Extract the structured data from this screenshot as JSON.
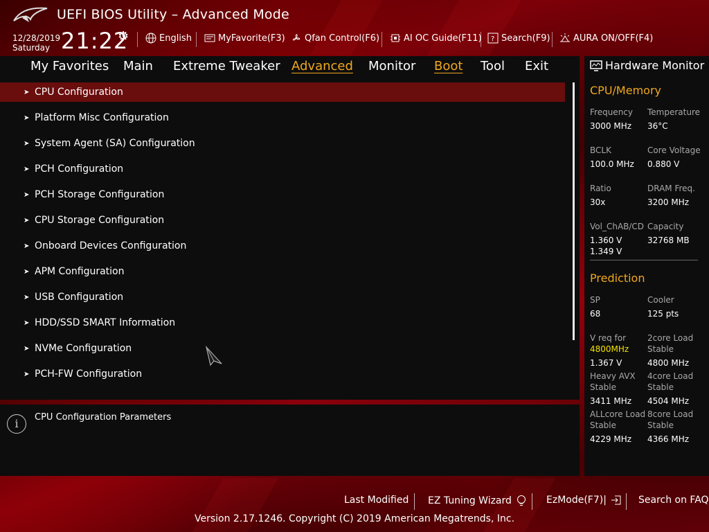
{
  "header": {
    "title": "UEFI BIOS Utility – Advanced Mode",
    "date": "12/28/2019",
    "day": "Saturday",
    "time": "21:22",
    "tools": [
      {
        "label": "English",
        "icon": "globe-icon"
      },
      {
        "label": "MyFavorite(F3)",
        "icon": "favorite-icon"
      },
      {
        "label": "Qfan Control(F6)",
        "icon": "fan-icon"
      },
      {
        "label": "AI OC Guide(F11)",
        "icon": "ai-guide-icon"
      },
      {
        "label": "Search(F9)",
        "icon": "search-icon"
      },
      {
        "label": "AURA ON/OFF(F4)",
        "icon": "aura-icon"
      }
    ]
  },
  "nav": {
    "tabs": [
      "My Favorites",
      "Main",
      "Extreme Tweaker",
      "Advanced",
      "Monitor",
      "Boot",
      "Tool",
      "Exit"
    ],
    "active": [
      "Advanced",
      "Boot"
    ]
  },
  "menu": {
    "items": [
      "CPU Configuration",
      "Platform Misc Configuration",
      "System Agent (SA) Configuration",
      "PCH Configuration",
      "PCH Storage Configuration",
      "CPU Storage Configuration",
      "Onboard Devices Configuration",
      "APM Configuration",
      "USB Configuration",
      "HDD/SSD SMART Information",
      "NVMe Configuration",
      "PCH-FW Configuration"
    ],
    "selected_index": 0
  },
  "help": {
    "text": "CPU Configuration Parameters"
  },
  "hardware_monitor": {
    "title": "Hardware Monitor",
    "cpu_memory": {
      "heading": "CPU/Memory",
      "frequency_label": "Frequency",
      "frequency_value": "3000 MHz",
      "temperature_label": "Temperature",
      "temperature_value": "36°C",
      "bclk_label": "BCLK",
      "bclk_value": "100.0 MHz",
      "core_voltage_label": "Core Voltage",
      "core_voltage_value": "0.880 V",
      "ratio_label": "Ratio",
      "ratio_value": "30x",
      "dram_freq_label": "DRAM Freq.",
      "dram_freq_value": "3200 MHz",
      "vol_label": "Vol_ChAB/CD",
      "vol_value_1": "1.360 V",
      "vol_value_2": "1.349 V",
      "capacity_label": "Capacity",
      "capacity_value": "32768 MB"
    },
    "prediction": {
      "heading": "Prediction",
      "sp_label": "SP",
      "sp_value": "68",
      "cooler_label": "Cooler",
      "cooler_value": "125 pts",
      "vreq_label": "V req for",
      "vreq_freq": "4800MHz",
      "vreq_value": "1.367 V",
      "core2_label_1": "2core Load",
      "core2_label_2": "Stable",
      "core2_value": "4800 MHz",
      "avx_label_1": "Heavy AVX",
      "avx_label_2": "Stable",
      "avx_value": "3411 MHz",
      "core4_label_1": "4core Load",
      "core4_label_2": "Stable",
      "core4_value": "4504 MHz",
      "allcore_label_1": "ALLcore Load",
      "allcore_label_2": "Stable",
      "allcore_value": "4229 MHz",
      "core8_label_1": "8core Load",
      "core8_label_2": "Stable",
      "core8_value": "4366 MHz"
    }
  },
  "footer": {
    "last_modified": "Last Modified",
    "ez_tuning": "EZ Tuning Wizard",
    "ezmode": "EzMode(F7)|",
    "search_faq": "Search on FAQ",
    "version": "Version 2.17.1246. Copyright (C) 2019 American Megatrends, Inc."
  },
  "colors": {
    "accent": "#f0a81e",
    "selected_row": "#6a0d0d",
    "panel": "#0d0d0d",
    "highlight_value": "#f5e100"
  }
}
